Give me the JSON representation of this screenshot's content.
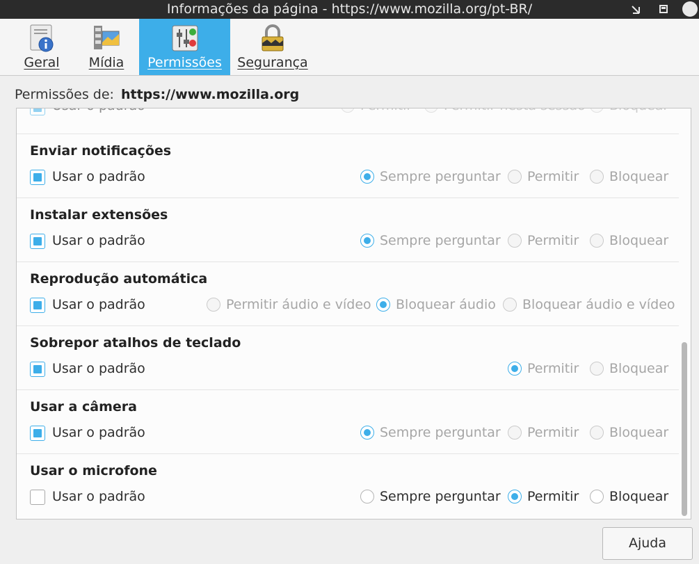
{
  "window": {
    "title": "Informações da página - https://www.mozilla.org/pt-BR/"
  },
  "tabs": [
    {
      "label": "Geral",
      "icon": "info-icon",
      "active": false
    },
    {
      "label": "Mídia",
      "icon": "media-icon",
      "active": false
    },
    {
      "label": "Permissões",
      "icon": "permissions-icon",
      "active": true
    },
    {
      "label": "Segurança",
      "icon": "lock-icon",
      "active": false
    }
  ],
  "permissions_of": {
    "label": "Permissões de:",
    "site": "https://www.mozilla.org"
  },
  "partial_row": {
    "default_label": "Usar o padrão",
    "options": [
      "Permitir",
      "Permitir nesta sessão",
      "Bloquear"
    ]
  },
  "sections": [
    {
      "title": "Enviar notificações",
      "default_label": "Usar o padrão",
      "use_default": true,
      "options": [
        "Sempre perguntar",
        "Permitir",
        "Bloquear"
      ],
      "selected": "Sempre perguntar"
    },
    {
      "title": "Instalar extensões",
      "default_label": "Usar o padrão",
      "use_default": true,
      "options": [
        "Sempre perguntar",
        "Permitir",
        "Bloquear"
      ],
      "selected": "Sempre perguntar"
    },
    {
      "title": "Reprodução automática",
      "default_label": "Usar o padrão",
      "use_default": true,
      "options": [
        "Permitir áudio e vídeo",
        "Bloquear áudio",
        "Bloquear áudio e vídeo"
      ],
      "selected": "Bloquear áudio"
    },
    {
      "title": "Sobrepor atalhos de teclado",
      "default_label": "Usar o padrão",
      "use_default": true,
      "options": [
        "Permitir",
        "Bloquear"
      ],
      "selected": "Permitir"
    },
    {
      "title": "Usar a câmera",
      "default_label": "Usar o padrão",
      "use_default": true,
      "options": [
        "Sempre perguntar",
        "Permitir",
        "Bloquear"
      ],
      "selected": "Sempre perguntar"
    },
    {
      "title": "Usar o microfone",
      "default_label": "Usar o padrão",
      "use_default": false,
      "options": [
        "Sempre perguntar",
        "Permitir",
        "Bloquear"
      ],
      "selected": "Permitir"
    }
  ],
  "footer": {
    "help_label": "Ajuda"
  },
  "colors": {
    "accent": "#3daee9",
    "titlebar": "#2b2b2b"
  }
}
